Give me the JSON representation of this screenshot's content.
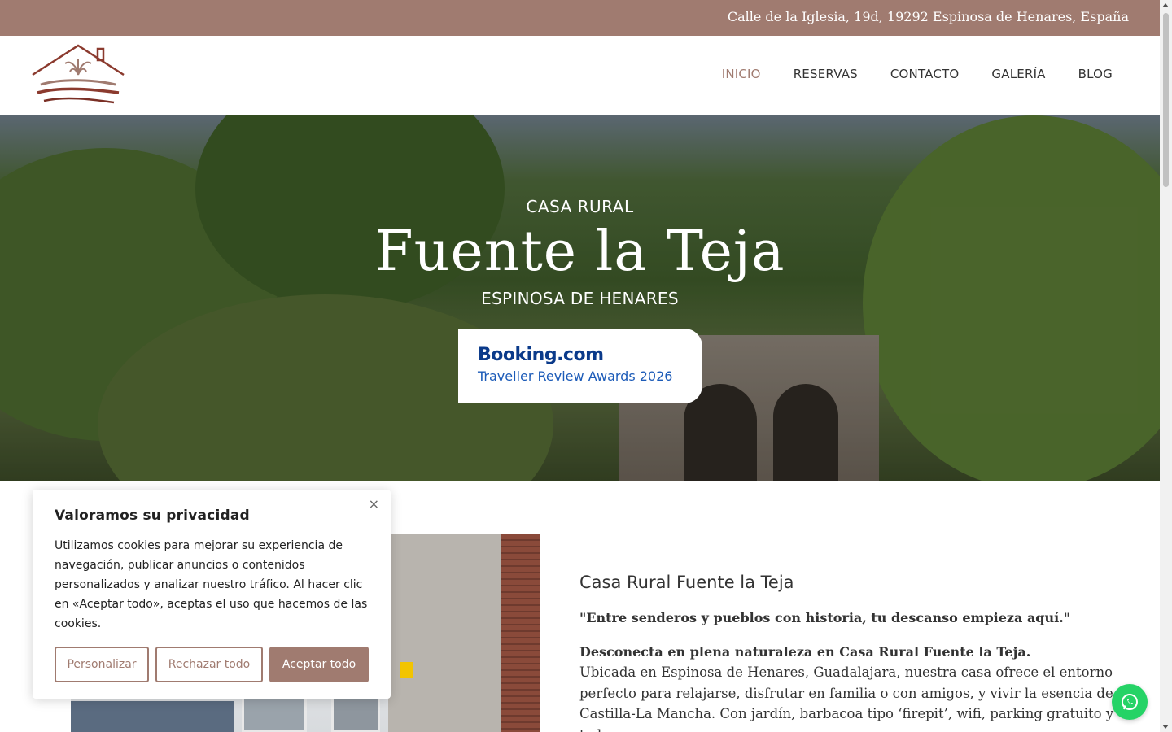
{
  "topbar": {
    "address": "Calle de la Iglesia, 19d, 19292 Espinosa de Henares, España"
  },
  "colors": {
    "brand": "#a07b70",
    "whatsapp": "#25d366",
    "booking_blue": "#0a3a8a"
  },
  "nav": {
    "items": [
      {
        "label": "INICIO",
        "active": true
      },
      {
        "label": "RESERVAS",
        "active": false
      },
      {
        "label": "CONTACTO",
        "active": false
      },
      {
        "label": "GALERÍA",
        "active": false
      },
      {
        "label": "BLOG",
        "active": false
      }
    ]
  },
  "hero": {
    "kicker": "CASA RURAL",
    "title": "Fuente la Teja",
    "subtitle": "ESPINOSA DE HENARES",
    "award": {
      "brand": "Booking.com",
      "text": "Traveller Review Awards 2026"
    }
  },
  "content": {
    "heading": "Casa Rural Fuente la Teja",
    "quote": "\"Entre senderos y pueblos con historia, tu descanso empieza aquí.\"",
    "lead": "Desconecta en plena naturaleza en Casa Rural Fuente la Teja.",
    "body": "Ubicada en Espinosa de Henares, Guadalajara, nuestra casa ofrece el entorno perfecto para relajarse, disfrutar en familia o con amigos, y vivir la esencia de Castilla-La Mancha. Con jardín, barbacoa tipo ‘firepit’, wifi, parking gratuito y todos"
  },
  "cookie": {
    "title": "Valoramos su privacidad",
    "text": "Utilizamos cookies para mejorar su experiencia de navegación, publicar anuncios o contenidos personalizados y analizar nuestro tráfico. Al hacer clic en «Aceptar todo», aceptas el uso que hacemos de las cookies.",
    "close": "×",
    "buttons": {
      "customize": "Personalizar",
      "reject": "Rechazar todo",
      "accept": "Aceptar todo"
    }
  },
  "icons": {
    "logo": "house-fountain-logo",
    "whatsapp": "whatsapp-icon"
  }
}
